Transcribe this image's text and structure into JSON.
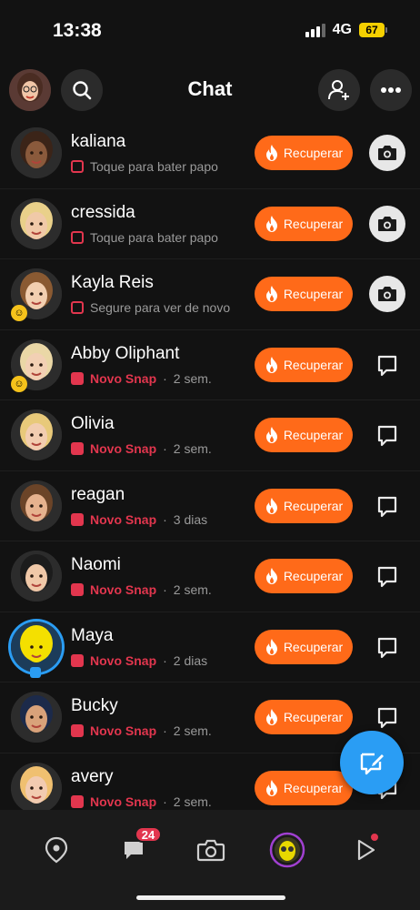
{
  "status": {
    "time": "13:38",
    "network": "4G",
    "battery": "67"
  },
  "header": {
    "title": "Chat"
  },
  "recover_label": "Recuperar",
  "chats": [
    {
      "name": "kaliana",
      "status": "Toque para bater papo",
      "time": "",
      "kind": "open",
      "action": "camera",
      "skin": "#8a5a3c",
      "hair": "#3b2418",
      "bg": "#2c2c2c"
    },
    {
      "name": "cressida",
      "status": "Toque para bater papo",
      "time": "",
      "kind": "open",
      "action": "camera",
      "skin": "#f0c9a8",
      "hair": "#e9d08a",
      "bg": "#2c2c2c"
    },
    {
      "name": "Kayla Reis",
      "status": "Segure para ver de novo",
      "time": "",
      "kind": "open",
      "action": "camera",
      "skin": "#f2cfb0",
      "hair": "#8a5a32",
      "bg": "#2c2c2c"
    },
    {
      "name": "Abby Oliphant",
      "status": "Novo Snap",
      "time": "2 sem.",
      "kind": "new",
      "action": "reply",
      "skin": "#f2d0b4",
      "hair": "#ead7a6",
      "bg": "#2c2c2c"
    },
    {
      "name": "Olivia",
      "status": "Novo Snap",
      "time": "2 sem.",
      "kind": "new",
      "action": "reply",
      "skin": "#f2cdb0",
      "hair": "#e8c97a",
      "bg": "#2c2c2c"
    },
    {
      "name": "reagan",
      "status": "Novo Snap",
      "time": "3 dias",
      "kind": "new",
      "action": "reply",
      "skin": "#e6b28e",
      "hair": "#6b4428",
      "bg": "#2c2c2c"
    },
    {
      "name": "Naomi",
      "status": "Novo Snap",
      "time": "2 sem.",
      "kind": "new",
      "action": "reply",
      "skin": "#f0c8a8",
      "hair": "#1c1c1c",
      "bg": "#2c2c2c"
    },
    {
      "name": "Maya",
      "status": "Novo Snap",
      "time": "2 dias",
      "kind": "new",
      "action": "reply",
      "skin": "#f4e000",
      "hair": "#f4e000",
      "bg": "#1c3c5a"
    },
    {
      "name": "Bucky",
      "status": "Novo Snap",
      "time": "2 sem.",
      "kind": "new",
      "action": "reply",
      "skin": "#d9a27a",
      "hair": "#1c2a4a",
      "bg": "#2c2c2c"
    },
    {
      "name": "avery",
      "status": "Novo Snap",
      "time": "2 sem.",
      "kind": "new",
      "action": "reply",
      "skin": "#f2cbb0",
      "hair": "#f0c070",
      "bg": "#2c2c2c"
    }
  ],
  "nav": {
    "chat_badge": "24"
  },
  "colors": {
    "accent": "#ff6a19",
    "new_snap": "#e2364e",
    "fab": "#2a9df4"
  }
}
